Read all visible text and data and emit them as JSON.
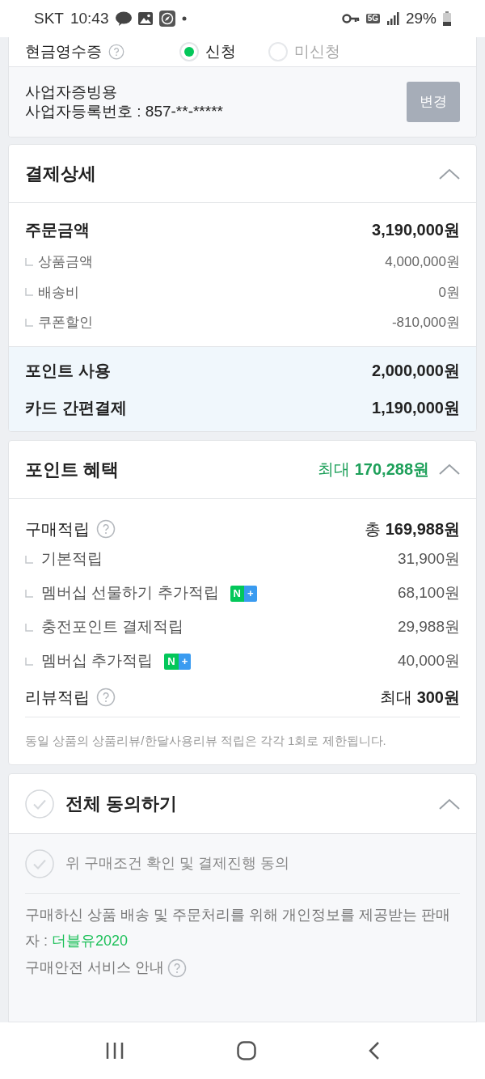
{
  "status_bar": {
    "carrier": "SKT",
    "time": "10:43",
    "network": "5G",
    "battery": "29%"
  },
  "cash_receipt": {
    "label": "현금영수증",
    "options": [
      {
        "label": "신청",
        "selected": true
      },
      {
        "label": "미신청",
        "selected": false
      }
    ]
  },
  "business_proof": {
    "title": "사업자증빙용",
    "number": "사업자등록번호 : 857-**-*****",
    "button": "변경"
  },
  "payment_detail": {
    "title": "결제상세",
    "expanded": true,
    "total": {
      "label": "주문금액",
      "value": "3,190,000원"
    },
    "items": [
      {
        "label": "상품금액",
        "value": "4,000,000원"
      },
      {
        "label": "배송비",
        "value": "0원"
      },
      {
        "label": "쿠폰할인",
        "value": "-810,000원"
      }
    ],
    "methods": [
      {
        "label": "포인트 사용",
        "value": "2,000,000원"
      },
      {
        "label": "카드 간편결제",
        "value": "1,190,000원"
      }
    ]
  },
  "points": {
    "title": "포인트 혜택",
    "max": "최대 **170,288원**",
    "expanded": true,
    "purchase": {
      "label": "구매적립",
      "value": "총 **169,988원**"
    },
    "items": [
      {
        "label": "기본적립",
        "value": "31,900원"
      },
      {
        "label": "멤버십 선물하기 추가적립",
        "value": "68,100원",
        "badge": {
          "left": "N",
          "right": "+"
        }
      },
      {
        "label": "충전포인트 결제적립",
        "value": "29,988원"
      },
      {
        "label": "멤버십 추가적립",
        "value": "40,000원",
        "badge": {
          "left": "N",
          "right": "+"
        }
      }
    ],
    "review": {
      "label": "리뷰적립",
      "value": "최대 **300원**"
    },
    "note": "동일 상품의 상품리뷰/한달사용리뷰 적립은 각각 1회로 제한됩니다."
  },
  "agreement": {
    "title": "전체 동의하기",
    "checked": false,
    "expanded": true,
    "items": [
      {
        "label": "위 구매조건 확인 및 결제진행 동의",
        "checked": false
      }
    ],
    "seller_text": "구매하신 상품 배송 및 주문처리를 위해 개인정보를 제공받는 판매자 : ",
    "seller": "더블유2020",
    "safety": "구매안전 서비스 안내"
  }
}
